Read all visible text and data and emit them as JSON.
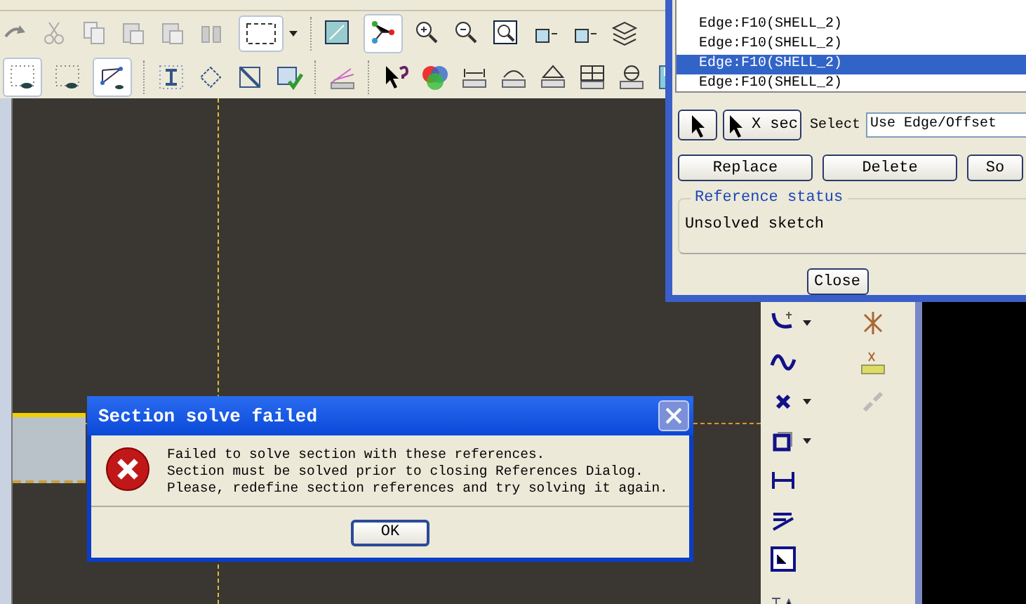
{
  "references_dialog": {
    "references": [
      {
        "label": "Edge:F10(SHELL_2)",
        "selected": false
      },
      {
        "label": "Edge:F10(SHELL_2)",
        "selected": false
      },
      {
        "label": "Edge:F10(SHELL_2)",
        "selected": true
      },
      {
        "label": "Edge:F10(SHELL_2)",
        "selected": false
      }
    ],
    "xsec_button": "X sec",
    "select_label": "Select",
    "select_value": "Use Edge/Offset",
    "buttons": [
      "Replace",
      "Delete",
      "So"
    ],
    "status_group": "Reference status",
    "status_text": "Unsolved sketch",
    "close_button": "Close"
  },
  "error_dialog": {
    "title": "Section solve failed",
    "message_lines": [
      "Failed to solve section with these references.",
      "Section must be solved prior to closing References Dialog.",
      "Please, redefine section references and try solving it again."
    ],
    "ok_button": "OK"
  }
}
